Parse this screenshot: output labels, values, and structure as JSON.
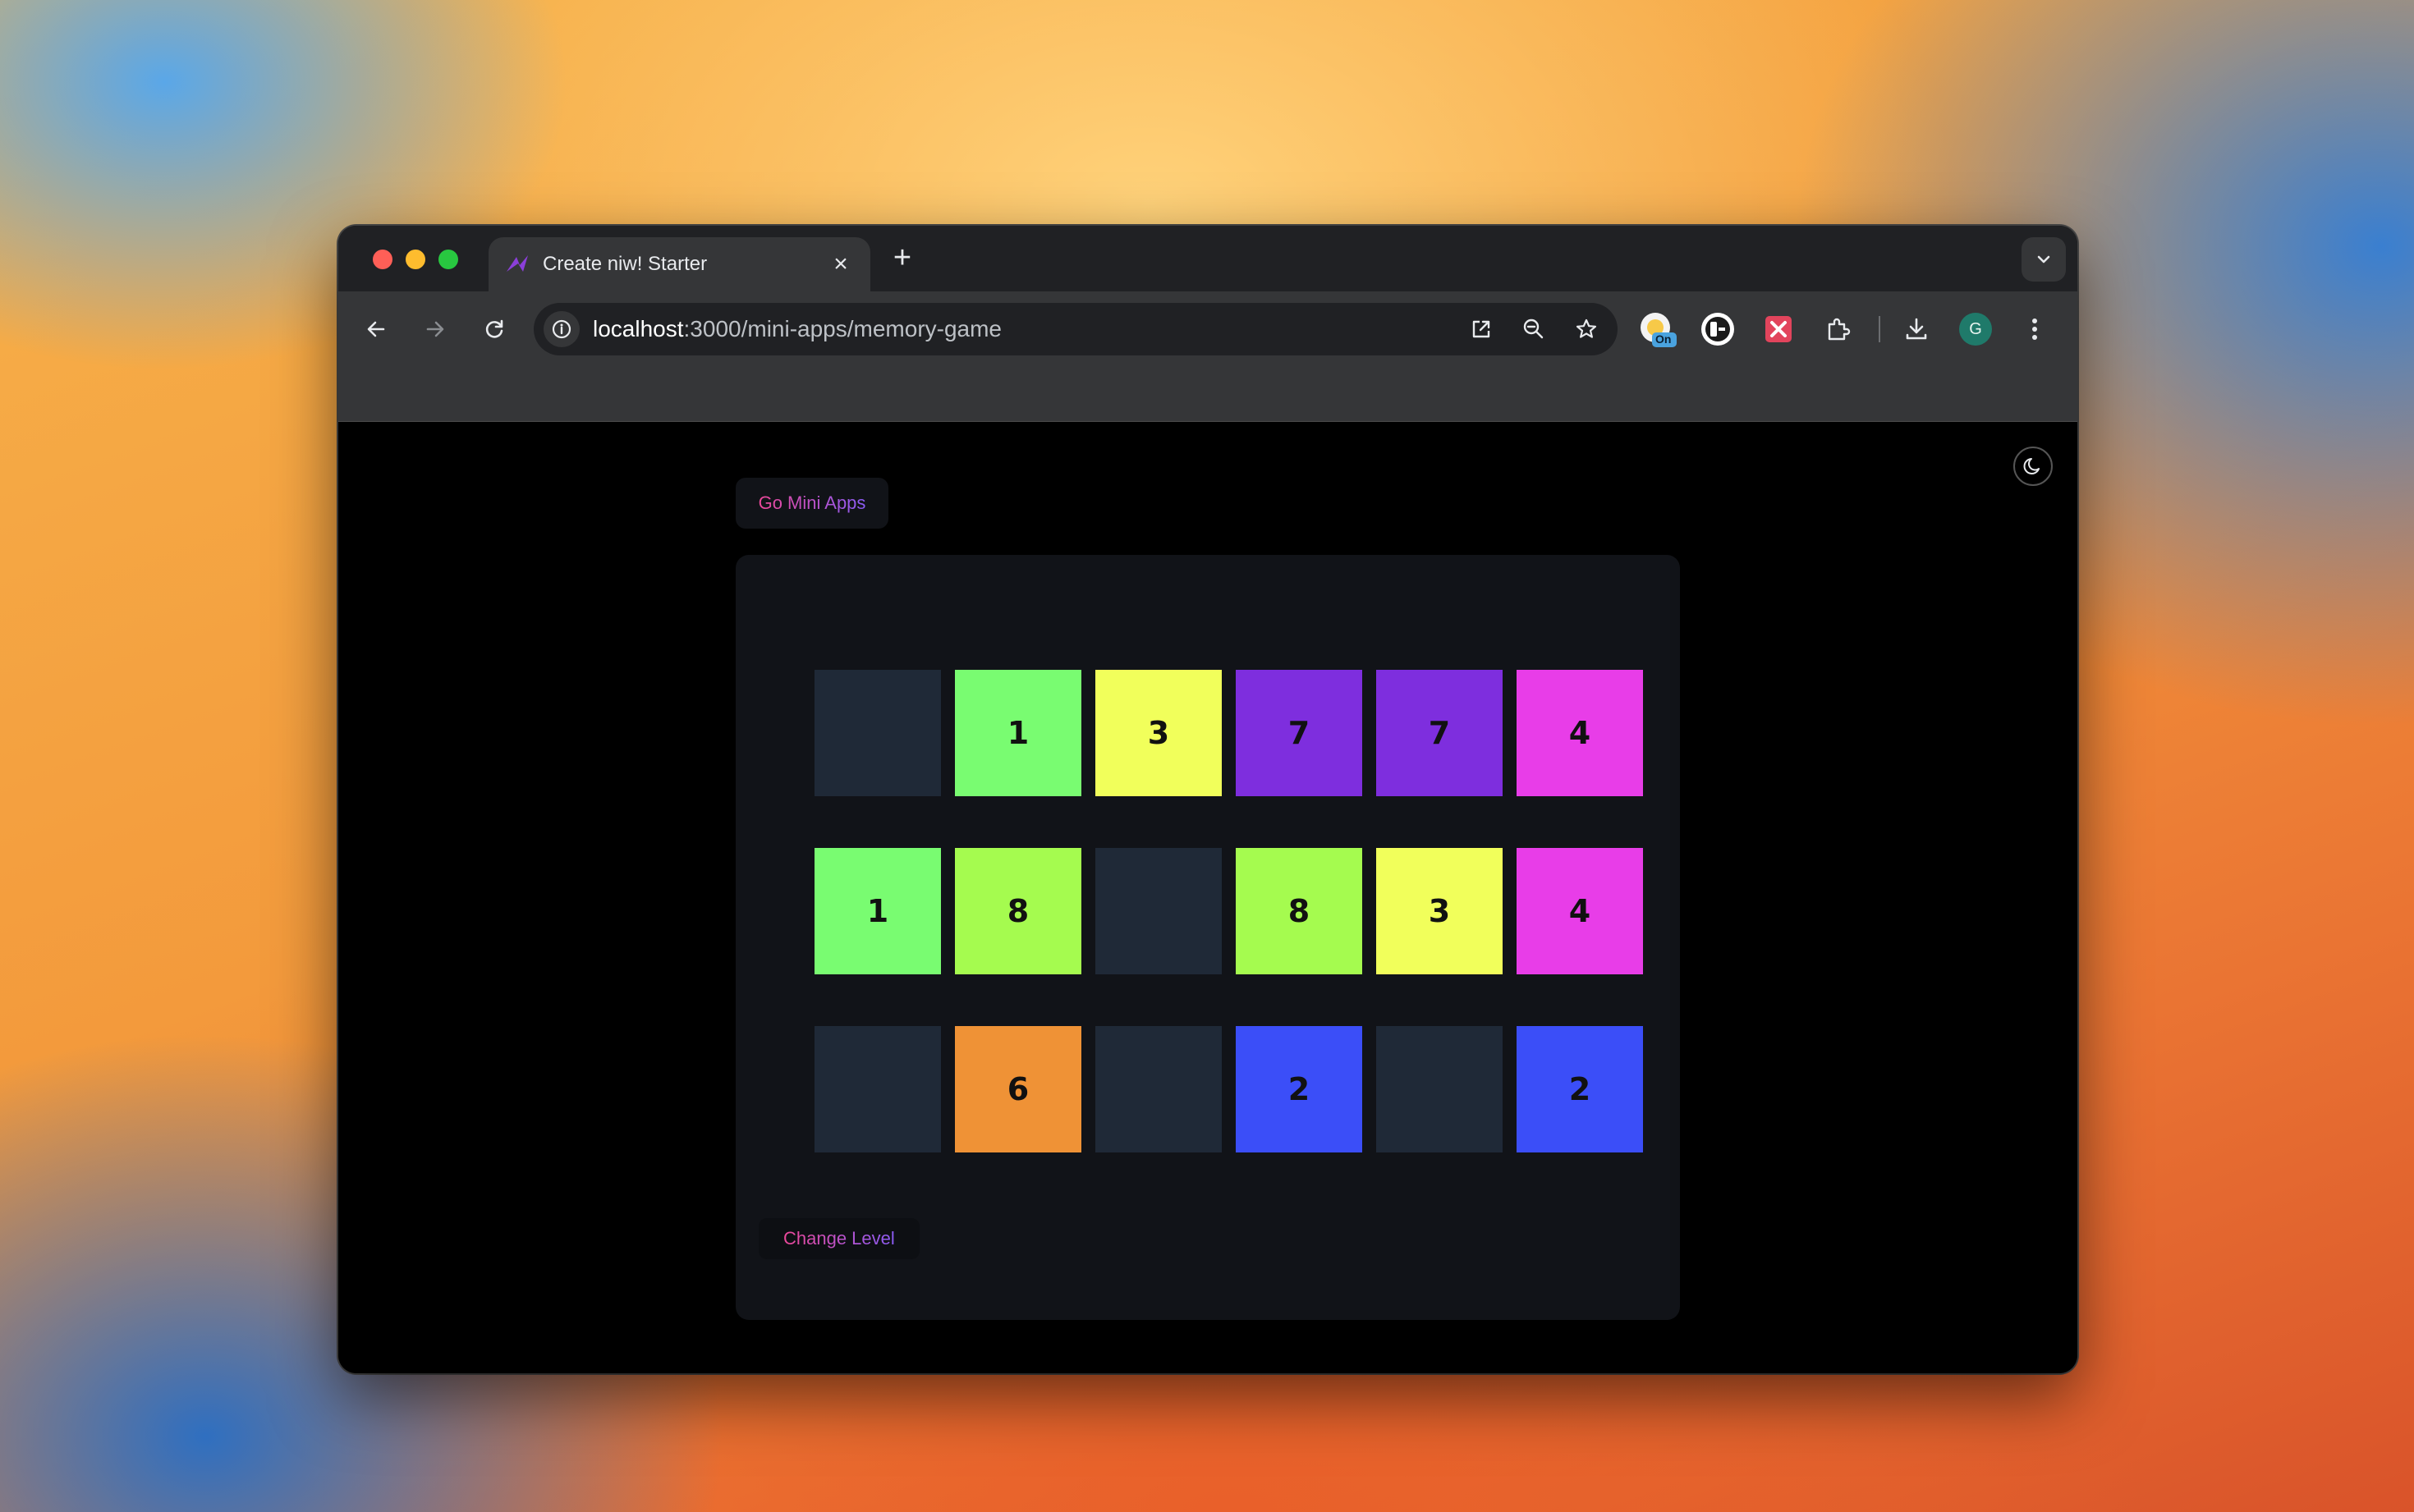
{
  "browser": {
    "tab_title": "Create niw! Starter",
    "tab_close_icon": "×",
    "new_tab_icon": "+",
    "url_host": "localhost",
    "url_path": ":3000/mini-apps/memory-game",
    "profile_initial": "G",
    "extension_badge": "On"
  },
  "page": {
    "go_button_label": "Go Mini Apps",
    "change_level_label": "Change Level"
  },
  "game": {
    "cards": [
      {
        "value": "",
        "color": "#1f2937",
        "revealed": false
      },
      {
        "value": "1",
        "color": "#79fc71",
        "revealed": true
      },
      {
        "value": "3",
        "color": "#f1ff5b",
        "revealed": true
      },
      {
        "value": "7",
        "color": "#7e2ede",
        "revealed": true
      },
      {
        "value": "7",
        "color": "#7e2ede",
        "revealed": true
      },
      {
        "value": "4",
        "color": "#e83de8",
        "revealed": true
      },
      {
        "value": "1",
        "color": "#79fc71",
        "revealed": true
      },
      {
        "value": "8",
        "color": "#a5fb4f",
        "revealed": true
      },
      {
        "value": "",
        "color": "#1f2937",
        "revealed": false
      },
      {
        "value": "8",
        "color": "#a5fb4f",
        "revealed": true
      },
      {
        "value": "3",
        "color": "#f1ff5b",
        "revealed": true
      },
      {
        "value": "4",
        "color": "#e83de8",
        "revealed": true
      },
      {
        "value": "",
        "color": "#1f2937",
        "revealed": false
      },
      {
        "value": "6",
        "color": "#ef9236",
        "revealed": true
      },
      {
        "value": "",
        "color": "#1f2937",
        "revealed": false
      },
      {
        "value": "2",
        "color": "#3b4ef8",
        "revealed": true
      },
      {
        "value": "",
        "color": "#1f2937",
        "revealed": false
      },
      {
        "value": "2",
        "color": "#3b4ef8",
        "revealed": true
      }
    ]
  },
  "colors": {
    "page_bg": "#000000",
    "panel_bg": "#111318",
    "hidden_card": "#1f2937",
    "accent_start": "#ec4899",
    "accent_end": "#8b5cf6"
  }
}
